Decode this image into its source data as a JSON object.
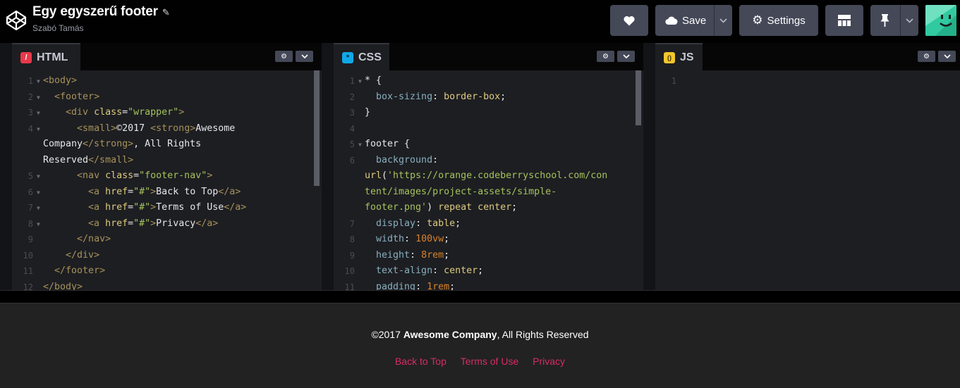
{
  "header": {
    "title": "Egy egyszerű footer",
    "author": "Szabó Tamás",
    "save_label": "Save",
    "settings_label": "Settings"
  },
  "panels": {
    "html": {
      "tab": "HTML",
      "badge": "/"
    },
    "css": {
      "tab": "CSS",
      "badge": "*"
    },
    "js": {
      "tab": "JS",
      "badge": "()"
    }
  },
  "html_code": [
    {
      "ln": "1",
      "text": "<body>"
    },
    {
      "ln": "2",
      "text": "  <footer>"
    },
    {
      "ln": "3",
      "text": "    <div class=\"wrapper\">"
    },
    {
      "ln": "4",
      "text": "      <small>©2017 <strong>Awesome"
    },
    {
      "ln": "",
      "text": "Company</strong>, All Rights"
    },
    {
      "ln": "",
      "text": "Reserved</small>"
    },
    {
      "ln": "5",
      "text": "      <nav class=\"footer-nav\">"
    },
    {
      "ln": "6",
      "text": "        <a href=\"#\">Back to Top</a>"
    },
    {
      "ln": "7",
      "text": "        <a href=\"#\">Terms of Use</a>"
    },
    {
      "ln": "8",
      "text": "        <a href=\"#\">Privacy</a>"
    },
    {
      "ln": "9",
      "text": "      </nav>"
    },
    {
      "ln": "10",
      "text": "    </div>"
    },
    {
      "ln": "11",
      "text": "  </footer>"
    },
    {
      "ln": "12",
      "text": "</body>"
    }
  ],
  "css_code": [
    {
      "ln": "1",
      "text": "* {"
    },
    {
      "ln": "2",
      "text": "  box-sizing: border-box;"
    },
    {
      "ln": "3",
      "text": "}"
    },
    {
      "ln": "4",
      "text": ""
    },
    {
      "ln": "5",
      "text": "footer {"
    },
    {
      "ln": "6",
      "text": "  background:"
    },
    {
      "ln": "",
      "text": "url('https://orange.codeberryschool.com/con"
    },
    {
      "ln": "",
      "text": "tent/images/project-assets/simple-"
    },
    {
      "ln": "",
      "text": "footer.png') repeat center;"
    },
    {
      "ln": "7",
      "text": "  display: table;"
    },
    {
      "ln": "8",
      "text": "  width: 100vw;"
    },
    {
      "ln": "9",
      "text": "  height: 8rem;"
    },
    {
      "ln": "10",
      "text": "  text-align: center;"
    },
    {
      "ln": "11",
      "text": "  padding: 1rem;"
    }
  ],
  "js_code": [
    {
      "ln": "1",
      "text": ""
    }
  ],
  "preview": {
    "copy_prefix": "©2017 ",
    "company": "Awesome Company",
    "copy_suffix": ", All Rights Reserved",
    "links": [
      "Back to Top",
      "Terms of Use",
      "Privacy"
    ]
  },
  "colors": {
    "link": "#d72b66",
    "preview_bg": "#222222",
    "editor_bg": "#1d1e22"
  }
}
